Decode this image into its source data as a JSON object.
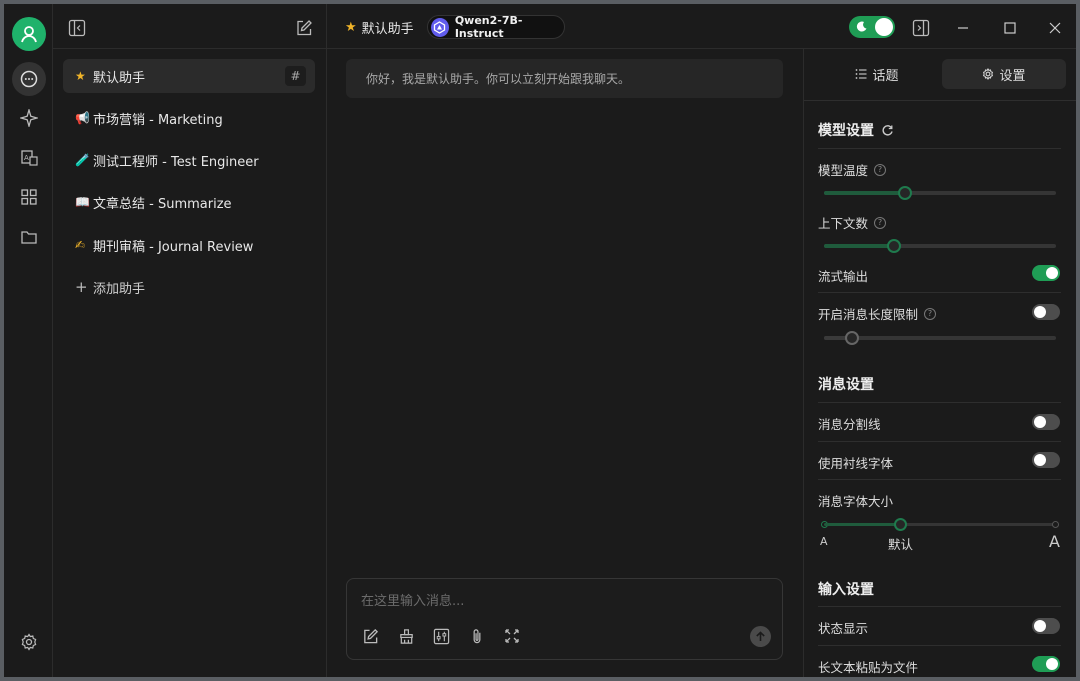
{
  "topbar": {
    "assistant_label": "默认助手",
    "model_name": "Qwen2-7B-Instruct"
  },
  "assistants": {
    "items": [
      {
        "emoji": "★",
        "label": "默认助手",
        "active": true
      },
      {
        "emoji": "📢",
        "label": "市场营销 - Marketing"
      },
      {
        "emoji": "🧪",
        "label": "测试工程师 - Test Engineer"
      },
      {
        "emoji": "📖",
        "label": "文章总结 - Summarize"
      },
      {
        "emoji": "✍",
        "label": "期刊审稿 - Journal Review"
      }
    ],
    "add_label": "添加助手",
    "hash_label": "#"
  },
  "chat": {
    "greeting": "你好，我是默认助手。你可以立刻开始跟我聊天。",
    "input_placeholder": "在这里输入消息..."
  },
  "panel": {
    "tab_topics": "话题",
    "tab_settings": "设置",
    "model_settings": {
      "title": "模型设置",
      "temperature_label": "模型温度",
      "temperature_level": 0.35,
      "context_label": "上下文数",
      "context_level": 0.3,
      "stream_label": "流式输出",
      "stream_on": true,
      "maxlen_label": "开启消息长度限制",
      "maxlen_on": false,
      "maxlen_level": 0.12
    },
    "message_settings": {
      "title": "消息设置",
      "divider_label": "消息分割线",
      "divider_on": false,
      "serif_label": "使用衬线字体",
      "serif_on": false,
      "fontsize_label": "消息字体大小",
      "fontsize_small": "A",
      "fontsize_default": "默认",
      "fontsize_large": "A",
      "fontsize_level": 0.33
    },
    "input_settings": {
      "title": "输入设置",
      "status_label": "状态显示",
      "status_on": false,
      "paste_label": "长文本粘贴为文件",
      "paste_on": true
    }
  },
  "colors": {
    "accent": "#1f9d55",
    "avatar": "#1fb26b",
    "background": "#1b1b1b"
  }
}
